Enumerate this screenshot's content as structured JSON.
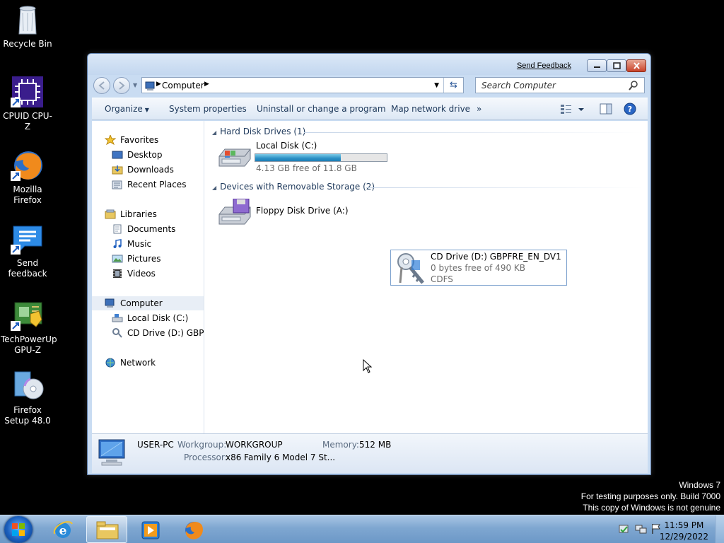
{
  "desktop": {
    "icons": [
      {
        "label": "Recycle Bin",
        "icon": "recycle-bin-icon"
      },
      {
        "label": "CPUID CPU-Z",
        "icon": "cpuz-icon"
      },
      {
        "label": "Mozilla Firefox",
        "icon": "firefox-icon"
      },
      {
        "label": "Send feedback",
        "icon": "send-feedback-icon"
      },
      {
        "label": "TechPowerUp GPU-Z",
        "icon": "gpuz-icon"
      },
      {
        "label": "Firefox Setup 48.0",
        "icon": "firefox-setup-icon"
      }
    ]
  },
  "window": {
    "send_feedback": "Send Feedback",
    "address": {
      "location": "Computer"
    },
    "search_placeholder": "Search Computer",
    "commands": {
      "organize": "Organize",
      "system_properties": "System properties",
      "uninstall": "Uninstall or change a program",
      "map_drive": "Map network drive",
      "more": "»"
    },
    "nav": {
      "favorites": "Favorites",
      "desktop": "Desktop",
      "downloads": "Downloads",
      "recent_places": "Recent Places",
      "libraries": "Libraries",
      "documents": "Documents",
      "music": "Music",
      "pictures": "Pictures",
      "videos": "Videos",
      "computer": "Computer",
      "local_disk": "Local Disk (C:)",
      "cd_drive": "CD Drive (D:) GBPFR",
      "network": "Network"
    },
    "groups": {
      "hdd": "Hard Disk Drives (1)",
      "removable": "Devices with Removable Storage (2)"
    },
    "drives": {
      "c": {
        "name": "Local Disk (C:)",
        "free_text": "4.13 GB free of 11.8 GB",
        "used_fraction": 0.65
      },
      "a": {
        "name": "Floppy Disk Drive (A:)"
      },
      "d": {
        "name": "CD Drive (D:) GBPFRE_EN_DV1",
        "free_text": "0 bytes free of 490 KB",
        "fs": "CDFS"
      }
    },
    "details": {
      "pc_name": "USER-PC",
      "workgroup_label": "Workgroup:",
      "workgroup": "WORKGROUP",
      "memory_label": "Memory:",
      "memory": "512 MB",
      "processor_label": "Processor:",
      "processor": "x86 Family 6 Model 7 St..."
    }
  },
  "watermark": {
    "line1": "Windows 7",
    "line2": "For testing purposes only. Build 7000",
    "line3": "This copy of Windows is not genuine"
  },
  "taskbar": {
    "time": "11:59 PM",
    "date": "12/29/2022"
  }
}
